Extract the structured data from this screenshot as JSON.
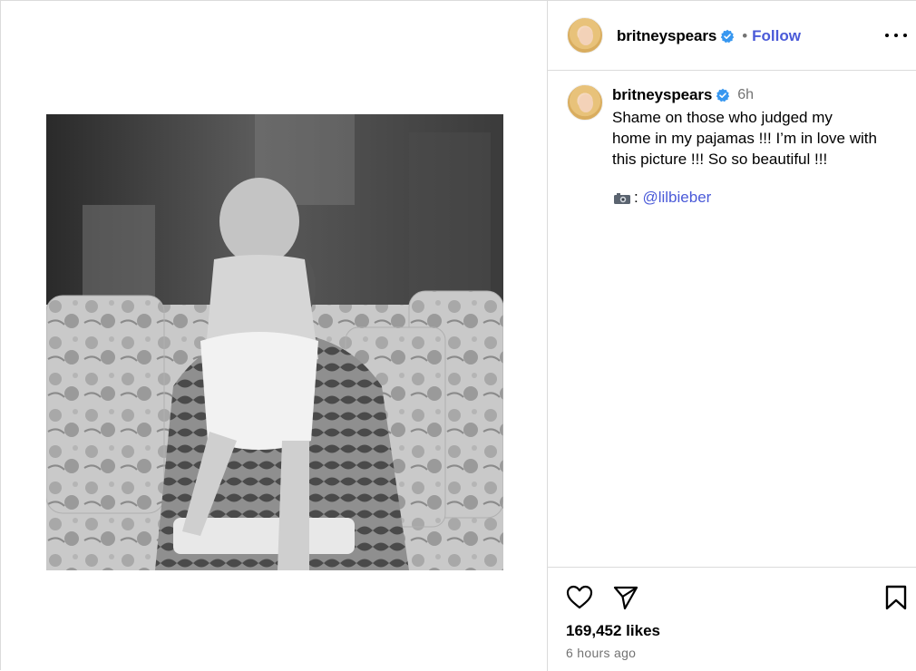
{
  "post": {
    "username": "britneyspears",
    "follow_label": "Follow",
    "separator": "•",
    "caption_time": "6h",
    "caption_lines": [
      "Shame on those who judged my",
      "home in my pajamas !!! I’m in love with",
      "this picture !!! So so beautiful !!!"
    ],
    "credit_separator": ":",
    "credit_mention": "@lilbieber",
    "likes": "169,452 likes",
    "posted_ago": "6 hours ago"
  },
  "icons": {
    "verified": "verified-badge-icon",
    "more": "more-options-icon",
    "camera": "camera-icon",
    "like": "heart-icon",
    "share": "send-icon",
    "save": "bookmark-icon"
  },
  "colors": {
    "link": "#4a5ad8",
    "muted": "#737373",
    "verified": "#3797f0",
    "border": "#dbdbdb"
  }
}
